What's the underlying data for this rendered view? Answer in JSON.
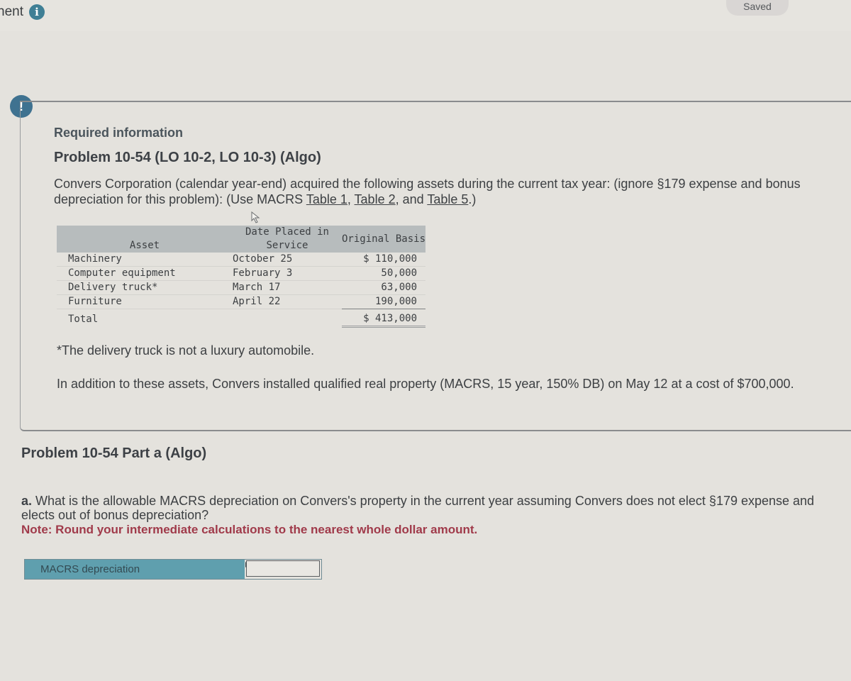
{
  "header": {
    "crumb_text": "nent",
    "info_icon": "info-icon",
    "saved_label": "Saved"
  },
  "alert_icon": "exclamation-icon",
  "required_info": {
    "label": "Required information",
    "problem_title": "Problem 10-54 (LO 10-2, LO 10-3) (Algo)",
    "intro_part1": "Convers Corporation (calendar year-end) acquired the following assets during the current tax year: (ignore §179 expense and bonus depreciation for this problem): (Use MACRS ",
    "links": [
      "Table 1",
      "Table 2",
      "Table 5"
    ],
    "intro_sep1": ", ",
    "intro_sep2": ", and ",
    "intro_end": ".)",
    "table": {
      "headers": {
        "asset": "Asset",
        "date": "Date Placed in Service",
        "basis": "Original Basis"
      },
      "rows": [
        {
          "asset": "Machinery",
          "date": "October 25",
          "basis": "$ 110,000"
        },
        {
          "asset": "Computer equipment",
          "date": "February 3",
          "basis": "50,000"
        },
        {
          "asset": "Delivery truck*",
          "date": "March 17",
          "basis": "63,000"
        },
        {
          "asset": "Furniture",
          "date": "April 22",
          "basis": "190,000"
        }
      ],
      "total": {
        "label": "Total",
        "basis": "$ 413,000"
      }
    },
    "footnote": "*The delivery truck is not a luxury automobile.",
    "additional": "In addition to these assets, Convers installed qualified real property (MACRS, 15 year, 150% DB) on May 12 at a cost of $700,000."
  },
  "part_a": {
    "title": "Problem 10-54 Part a (Algo)",
    "question_prefix": "a.",
    "question": "What is the allowable MACRS depreciation on Convers's property in the current year assuming Convers does not elect §179 expense and elects out of bonus depreciation?",
    "note": "Note: Round your intermediate calculations to the nearest whole dollar amount.",
    "answer_label": "MACRS depreciation",
    "answer_value": ""
  },
  "colors": {
    "background": "#e4e2dd",
    "accent_teal": "#5f9fae",
    "icon_blue": "#3f7290",
    "note_red": "#a03a4a",
    "table_header": "#b7bcbd"
  }
}
